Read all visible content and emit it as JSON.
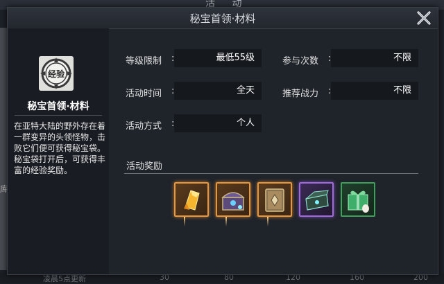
{
  "background": {
    "title_text": "活 动",
    "left_text": "库",
    "scale_text": "凌晨5点更新",
    "scale_ticks": [
      "30",
      "80",
      "120",
      "160",
      "200"
    ]
  },
  "dialog": {
    "title": "秘宝首领·材料"
  },
  "boss": {
    "badge_text": "经验",
    "name": "秘宝首领·材料",
    "description": "在亚特大陆的野外存在着一群变异的头领怪物，击败它们便可获得秘宝袋。秘宝袋打开后，可获得丰富的经验奖励。"
  },
  "info": {
    "level_label": "等级限制",
    "level_value": "最低55级",
    "times_label": "参与次数",
    "times_value": "不限",
    "time_label": "活动时间",
    "time_value": "全天",
    "power_label": "推荐战力",
    "power_value": "不限",
    "mode_label": "活动方式",
    "mode_value": "个人",
    "colon": ":"
  },
  "rewards": {
    "title": "活动奖励",
    "items": [
      {
        "icon": "gold-crystal-icon",
        "rarity": "orange"
      },
      {
        "icon": "treasure-chest-icon",
        "rarity": "orange"
      },
      {
        "icon": "skill-book-icon",
        "rarity": "orange"
      },
      {
        "icon": "jade-chest-icon",
        "rarity": "purple"
      },
      {
        "icon": "gift-box-icon",
        "rarity": "green"
      }
    ]
  },
  "colors": {
    "orange_rarity": "#e8983a",
    "purple_rarity": "#a06be0",
    "green_rarity": "#3fa05a"
  }
}
